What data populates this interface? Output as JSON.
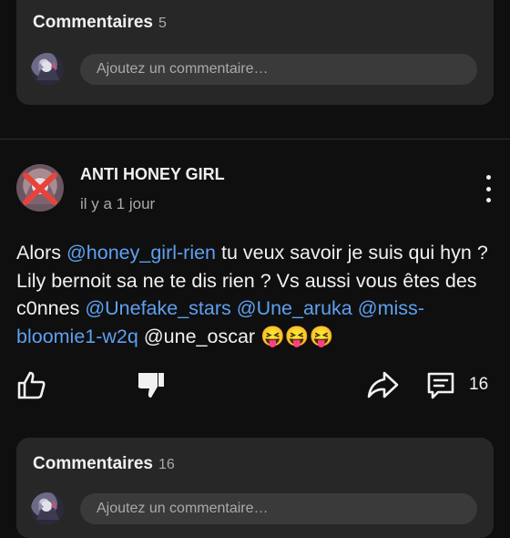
{
  "top_comments": {
    "title": "Commentaires",
    "count": "5",
    "placeholder": "Ajoutez un commentaire…"
  },
  "post": {
    "author": "ANTI HONEY GIRL",
    "time": "il y a 1 jour",
    "body": [
      {
        "text": "Alors ",
        "mention": false
      },
      {
        "text": "@honey_girl-rien",
        "mention": true
      },
      {
        "text": " tu veux savoir je suis qui hyn ? Lily bernoit sa ne te dis rien ? Vs aussi vous êtes des c0nnes ",
        "mention": false
      },
      {
        "text": "@Unefake_stars",
        "mention": true
      },
      {
        "text": " ",
        "mention": false
      },
      {
        "text": "@Une_aruka",
        "mention": true
      },
      {
        "text": " ",
        "mention": false
      },
      {
        "text": "@miss-bloomie1-w2q",
        "mention": true
      },
      {
        "text": " @une_oscar 😝😝😝",
        "mention": false
      }
    ],
    "comment_count": "16"
  },
  "bottom_comments": {
    "title": "Commentaires",
    "count": "16",
    "placeholder": "Ajoutez un commentaire…"
  },
  "icons": {
    "like": "thumb-up-icon",
    "dislike": "thumb-down-icon",
    "share": "share-icon",
    "comments": "comment-icon",
    "menu": "more-vert-icon"
  },
  "colors": {
    "background": "#0f0f0f",
    "card": "#272727",
    "mention": "#5ea0f0"
  }
}
